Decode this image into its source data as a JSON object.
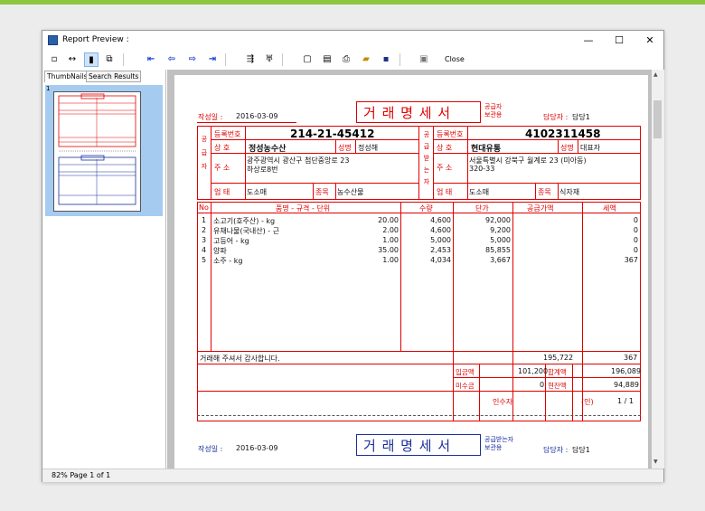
{
  "window": {
    "title": "Report Preview :",
    "close_label": "Close"
  },
  "tabs": [
    "ThumbNails",
    "Search Results"
  ],
  "thumb": {
    "page_number": "1"
  },
  "status": "82%  Page 1 of 1",
  "invoice": {
    "title": "거 래 명 세 서",
    "copy_top": "공급자",
    "copy_bottom": "보관용",
    "date_label": "작성일 :",
    "date": "2016-03-09",
    "manager_label": "담당자 :",
    "manager": "담당1",
    "supplier": {
      "section": "공급자",
      "reg_label": "등록번호",
      "reg": "214-21-45412",
      "name_label": "상    호",
      "name": "정성농수산",
      "rep_label": "성명",
      "rep": "정성해",
      "addr_label": "주    소",
      "addr1": "광주광역시 광산구 첨단중앙로 23",
      "addr2": "하상로8번",
      "type_label": "업    태",
      "type": "도소매",
      "item_label": "종목",
      "item": "농수산물"
    },
    "buyer": {
      "section": "공급받는자",
      "reg_label": "등록번호",
      "reg": "4102311458",
      "name_label": "상    호",
      "name": "현대유통",
      "rep_label": "성명",
      "rep": "대표자",
      "addr_label": "주    소",
      "addr1": "서울특별시 강북구 월계로 23 (미아동)",
      "addr2": "320-33",
      "type_label": "업    태",
      "type": "도소매",
      "item_label": "종목",
      "item": "식자재"
    },
    "columns": [
      "No",
      "품명 - 규격 - 단위",
      "수량",
      "단가",
      "공급가액",
      "세액"
    ],
    "rows": [
      {
        "no": "1",
        "name": "소고기(호주산) - kg",
        "qty": "20.00",
        "price": "4,600",
        "supply": "92,000",
        "tax": "0"
      },
      {
        "no": "2",
        "name": "유채나물(국내산) - 근",
        "qty": "2.00",
        "price": "4,600",
        "supply": "9,200",
        "tax": "0"
      },
      {
        "no": "3",
        "name": "고등어 - kg",
        "qty": "1.00",
        "price": "5,000",
        "supply": "5,000",
        "tax": "0"
      },
      {
        "no": "4",
        "name": "양파",
        "qty": "35.00",
        "price": "2,453",
        "supply": "85,855",
        "tax": "0"
      },
      {
        "no": "5",
        "name": "소주 - kg",
        "qty": "1.00",
        "price": "4,034",
        "supply": "3,667",
        "tax": "367"
      }
    ],
    "thanks": "거래해 주셔서 감사합니다.",
    "total_supply": "195,722",
    "total_tax": "367",
    "paid_label": "입금액",
    "paid": "101,200",
    "sum_label": "합계액",
    "sum": "196,089",
    "unpaid_label": "미수금",
    "unpaid": "0",
    "balance_label": "현잔액",
    "balance": "94,889",
    "receiver_label": "인수자",
    "seal_label": "(인)",
    "page": "1 / 1",
    "copy2_top": "공급받는자",
    "copy2_bottom": "보관용"
  }
}
